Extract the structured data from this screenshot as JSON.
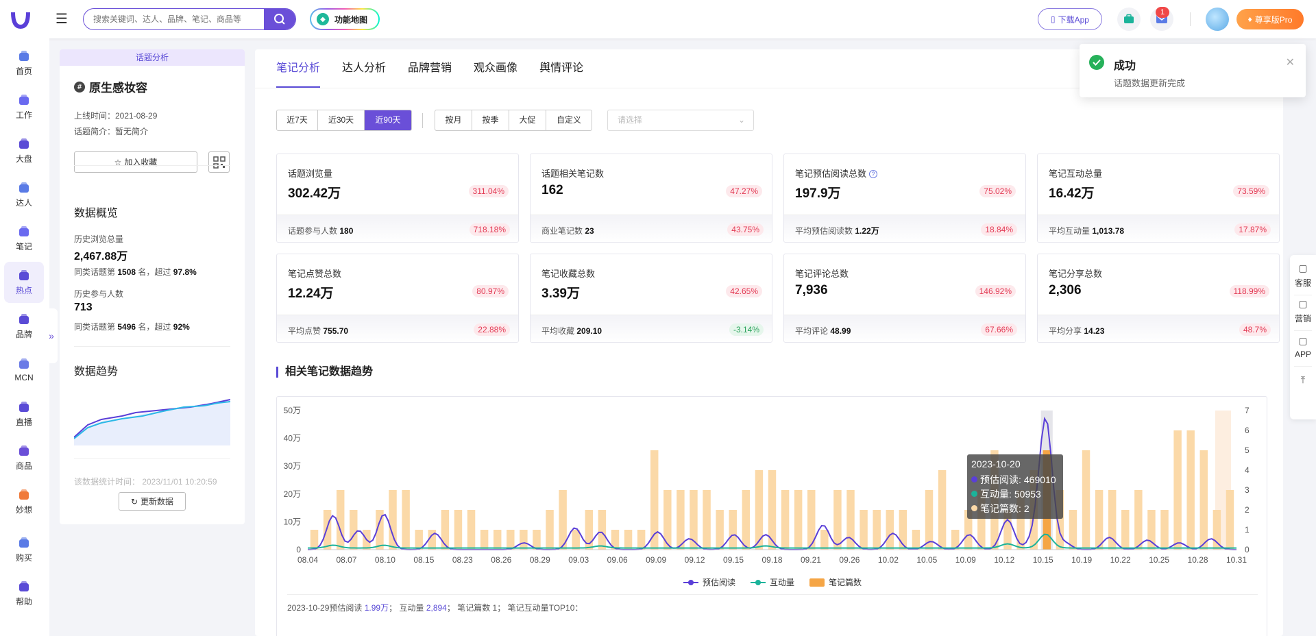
{
  "header": {
    "search_placeholder": "搜索关键词、达人、品牌、笔记、商品等",
    "func_map": "功能地图",
    "download_app": "下载App",
    "mail_badge": "1",
    "pro": "尊享版Pro"
  },
  "sidebar": {
    "items": [
      {
        "label": "首页",
        "icon": "home-icon"
      },
      {
        "label": "工作",
        "icon": "work-icon"
      },
      {
        "label": "大盘",
        "icon": "pie-icon"
      },
      {
        "label": "达人",
        "icon": "user-icon"
      },
      {
        "label": "笔记",
        "icon": "note-icon"
      },
      {
        "label": "热点",
        "icon": "fire-icon"
      },
      {
        "label": "品牌",
        "icon": "brand-icon"
      },
      {
        "label": "MCN",
        "icon": "mcn-icon"
      },
      {
        "label": "直播",
        "icon": "live-icon"
      },
      {
        "label": "商品",
        "icon": "goods-icon"
      },
      {
        "label": "妙想",
        "icon": "bulb-icon"
      },
      {
        "label": "购买",
        "icon": "cart-icon"
      },
      {
        "label": "帮助",
        "icon": "help-icon"
      }
    ],
    "collapse": "»"
  },
  "topic": {
    "tag": "话题分析",
    "title": "原生感妆容",
    "online_time": "上线时间：2021-08-29",
    "intro": "话题简介：暂无简介",
    "fav_button": "加入收藏",
    "overview_title": "数据概览",
    "hist_views_label": "历史浏览总量",
    "hist_views": "2,467.88万",
    "hist_views_rank_a": "同类话题第",
    "hist_views_rank_num": "1508",
    "hist_views_rank_b": "名，超过",
    "hist_views_rank_pct": "97.8%",
    "hist_users_label": "历史参与人数",
    "hist_users": "713",
    "hist_users_rank_a": "同类话题第",
    "hist_users_rank_num": "5496",
    "hist_users_rank_b": "名，超过",
    "hist_users_rank_pct": "92%",
    "trend_title": "数据趋势",
    "stat_time": "该数据统计时间：  2023/11/01 10:20:59",
    "refresh": "更新数据"
  },
  "tabs": [
    "笔记分析",
    "达人分析",
    "品牌营销",
    "观众画像",
    "舆情评论"
  ],
  "filters": {
    "range": [
      "近7天",
      "近30天",
      "近90天"
    ],
    "range_active": 2,
    "period": [
      "按月",
      "按季",
      "大促",
      "自定义"
    ],
    "select_placeholder": "请选择"
  },
  "cards": [
    {
      "label": "话题浏览量",
      "value": "302.42万",
      "pct": "311.04%",
      "sub_label": "话题参与人数",
      "sub_value": "180",
      "sub_pct": "718.18%",
      "neg": false
    },
    {
      "label": "话题相关笔记数",
      "value": "162",
      "pct": "47.27%",
      "sub_label": "商业笔记数",
      "sub_value": "23",
      "sub_pct": "43.75%",
      "neg": false
    },
    {
      "label": "笔记预估阅读总数",
      "value": "197.9万",
      "pct": "75.02%",
      "sub_label": "平均预估阅读数",
      "sub_value": "1.22万",
      "sub_pct": "18.84%",
      "neg": false,
      "help": true
    },
    {
      "label": "笔记互动总量",
      "value": "16.42万",
      "pct": "73.59%",
      "sub_label": "平均互动量",
      "sub_value": "1,013.78",
      "sub_pct": "17.87%",
      "neg": false
    },
    {
      "label": "笔记点赞总数",
      "value": "12.24万",
      "pct": "80.97%",
      "sub_label": "平均点赞",
      "sub_value": "755.70",
      "sub_pct": "22.88%",
      "neg": false
    },
    {
      "label": "笔记收藏总数",
      "value": "3.39万",
      "pct": "42.65%",
      "sub_label": "平均收藏",
      "sub_value": "209.10",
      "sub_pct": "-3.14%",
      "neg": true
    },
    {
      "label": "笔记评论总数",
      "value": "7,936",
      "pct": "146.92%",
      "sub_label": "平均评论",
      "sub_value": "48.99",
      "sub_pct": "67.66%",
      "neg": false
    },
    {
      "label": "笔记分享总数",
      "value": "2,306",
      "pct": "118.99%",
      "sub_label": "平均分享",
      "sub_value": "14.23",
      "sub_pct": "48.7%",
      "neg": false
    }
  ],
  "trend_section_title": "相关笔记数据趋势",
  "chart_data": {
    "type": "bar",
    "x_ticks": [
      "08.04",
      "08.07",
      "08.10",
      "08.15",
      "08.23",
      "08.26",
      "08.29",
      "09.03",
      "09.06",
      "09.09",
      "09.12",
      "09.15",
      "09.18",
      "09.21",
      "09.26",
      "10.02",
      "10.05",
      "10.09",
      "10.12",
      "10.15",
      "10.19",
      "10.22",
      "10.25",
      "10.28",
      "10.31"
    ],
    "y_left_ticks": [
      "0",
      "10万",
      "20万",
      "30万",
      "40万",
      "50万"
    ],
    "y_left_lim": [
      0,
      500000
    ],
    "y_right_ticks": [
      "0",
      "1",
      "2",
      "3",
      "4",
      "5",
      "6",
      "7"
    ],
    "y_right_lim": [
      0,
      7
    ],
    "notes_count": [
      1,
      2,
      3,
      2,
      1,
      2,
      3,
      3,
      1,
      1,
      2,
      2,
      2,
      1,
      1,
      1,
      1,
      1,
      2,
      3,
      1,
      2,
      2,
      1,
      1,
      1,
      5,
      3,
      3,
      3,
      3,
      2,
      2,
      3,
      4,
      4,
      3,
      3,
      3,
      1,
      3,
      3,
      2,
      2,
      2,
      2,
      1,
      3,
      4,
      1,
      2,
      3,
      5,
      2,
      3,
      4,
      5,
      3,
      2,
      5,
      3,
      3,
      2,
      3,
      2,
      2,
      6,
      6,
      5,
      2,
      3
    ],
    "series": [
      {
        "name": "预估阅读",
        "color": "#5a3fd8"
      },
      {
        "name": "互动量",
        "color": "#1bb39a"
      },
      {
        "name": "笔记篇数",
        "color": "#f5a545"
      }
    ],
    "tooltip": {
      "date": "2023-10-20",
      "read_label": "预估阅读: ",
      "read": "469010",
      "interact_label": "互动量: ",
      "interact": "50953",
      "notes_label": "笔记篇数: ",
      "notes": "2"
    },
    "footer_date": "2023-10-29",
    "footer_read_label": "预估阅读",
    "footer_read": "1.99万",
    "footer_interact_label": "互动量",
    "footer_interact": "2,894",
    "footer_notes_label": "笔记篇数",
    "footer_notes": "1",
    "footer_top": "笔记互动量TOP10："
  },
  "toast": {
    "title": "成功",
    "message": "话题数据更新完成"
  },
  "rightbar": [
    {
      "label": "客服",
      "icon": "headset-icon"
    },
    {
      "label": "营销",
      "icon": "chart-icon"
    },
    {
      "label": "APP",
      "icon": "phone-icon"
    }
  ],
  "colors": {
    "accent": "#5a4bd6",
    "up": "#e33b55",
    "down": "#2ba35c",
    "bar": "#fbd9a8"
  }
}
